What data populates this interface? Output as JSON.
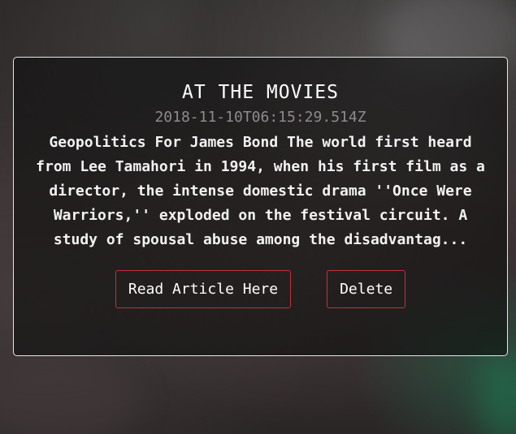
{
  "card": {
    "title": "AT THE MOVIES",
    "timestamp": "2018-11-10T06:15:29.514Z",
    "snippet": "Geopolitics For James Bond The world first heard from Lee Tamahori in 1994, when his first film as a director, the intense domestic drama ''Once Were Warriors,'' exploded on the festival circuit. A study of spousal abuse among the disadvantag..."
  },
  "actions": {
    "read_label": "Read Article Here",
    "delete_label": "Delete"
  },
  "colors": {
    "button_border": "#c0323c",
    "card_border": "#e6e6e6",
    "timestamp": "#8c8c8c"
  }
}
